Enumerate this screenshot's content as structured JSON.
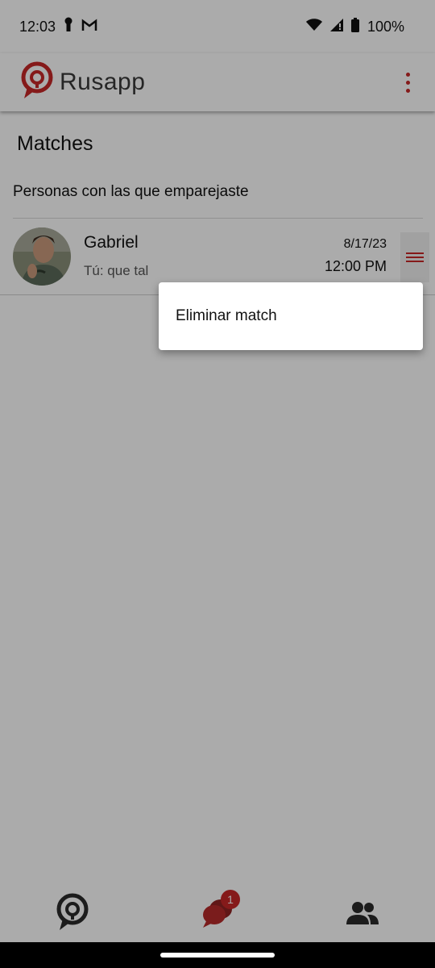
{
  "status_bar": {
    "time": "12:03",
    "battery": "100%",
    "icons": [
      "keyhole-icon",
      "gmail-icon",
      "wifi-icon",
      "signal-icon",
      "battery-icon"
    ]
  },
  "app_bar": {
    "app_name": "Rusapp",
    "icons": [
      "rusapp-logo-icon",
      "more-vert-icon"
    ]
  },
  "page": {
    "title": "Matches",
    "subtitle": "Personas con las que emparejaste"
  },
  "matches": [
    {
      "name": "Gabriel",
      "last_message": "Tú: que tal",
      "date": "8/17/23",
      "time": "12:00 PM"
    }
  ],
  "popup_menu": {
    "items": [
      "Eliminar match"
    ]
  },
  "bottom_nav": {
    "items": [
      {
        "icon": "home-logo-icon"
      },
      {
        "icon": "chat-bubbles-icon",
        "badge": "1"
      },
      {
        "icon": "people-icon"
      }
    ]
  },
  "colors": {
    "accent": "#c62828",
    "overlay": "rgba(0,0,0,0.33)"
  }
}
